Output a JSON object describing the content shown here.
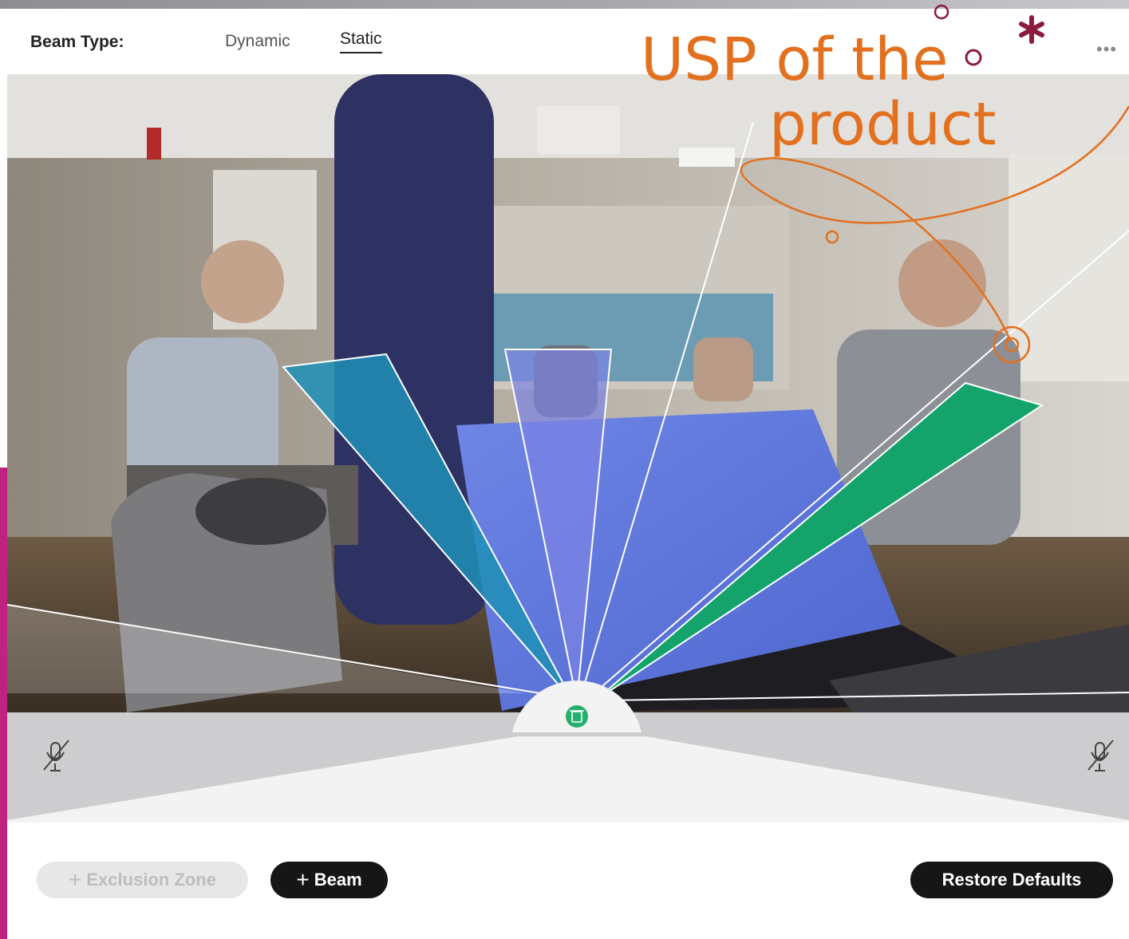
{
  "toolbar": {
    "beam_type_label": "Beam Type:",
    "tabs": [
      "Dynamic",
      "Static"
    ],
    "selected_tab": "Static",
    "more_icon": "more-horizontal-icon"
  },
  "annotation": {
    "line1": "USP of the",
    "line2": "product",
    "color": "#e2701e",
    "asterisk_color": "#8c1a3c"
  },
  "beams": [
    {
      "name": "beam-1",
      "color": "#1f8fb6"
    },
    {
      "name": "beam-2",
      "color": "#7c83e4"
    },
    {
      "name": "beam-3",
      "color": "#14a46b"
    }
  ],
  "hub": {
    "icon": "trash-icon",
    "color": "#25b06d"
  },
  "mic_icons": [
    "mic-muted-icon",
    "mic-muted-icon"
  ],
  "buttons": {
    "exclusion_zone": "Exclusion Zone",
    "beam": "Beam",
    "restore_defaults": "Restore Defaults"
  },
  "colors": {
    "accent_bar": "#c0227f",
    "button_dark": "#161616"
  }
}
